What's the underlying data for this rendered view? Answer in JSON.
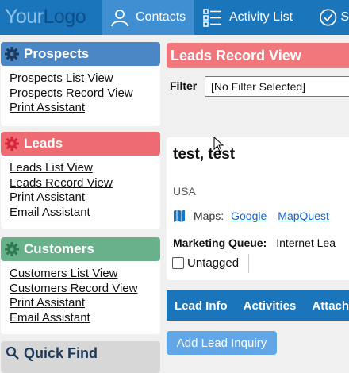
{
  "logo": {
    "part1": "Your",
    "part2": "Logo"
  },
  "nav": {
    "contacts_label": "Contacts",
    "activity_label": "Activity List",
    "next_label": "S"
  },
  "sidebar": {
    "prospects": {
      "title": "Prospects",
      "links": [
        "Prospects List View",
        "Prospects Record View",
        "Print Assistant"
      ]
    },
    "leads": {
      "title": "Leads",
      "links": [
        "Leads List View",
        "Leads Record View",
        "Print Assistant",
        "Email Assistant"
      ]
    },
    "customers": {
      "title": "Customers",
      "links": [
        "Customers List View",
        "Customers Record View",
        "Print Assistant",
        "Email Assistant"
      ]
    },
    "quick_find": {
      "title": "Quick Find"
    }
  },
  "main": {
    "title": "Leads Record View",
    "filter_label": "Filter",
    "filter_value": "[No Filter Selected]",
    "record": {
      "name": "test, test",
      "country": "USA",
      "maps_label": "Maps:",
      "map_links": [
        "Google",
        "MapQuest"
      ],
      "queue_label": "Marketing Queue:",
      "queue_value": "Internet Lea",
      "tag_label": "Untagged"
    },
    "tabs": [
      "Lead Info",
      "Activities",
      "Attach"
    ],
    "add_button": "Add Lead Inquiry"
  },
  "colors": {
    "nav": "#1b75bb",
    "nav_active": "#3f8fd2",
    "prospects": "#4b87c5",
    "leads": "#ef6b73",
    "customers": "#69b18a",
    "leads_header": "#f2777d",
    "button": "#61a6e6",
    "link": "#1b5fc1"
  },
  "icons": {
    "contacts": "person-icon",
    "activity": "list-icon",
    "next": "check-circle-icon",
    "prospects": "gear-icon",
    "leads": "gear-icon",
    "customers": "gear-icon",
    "quick_find": "search-icon",
    "maps": "map-icon"
  }
}
